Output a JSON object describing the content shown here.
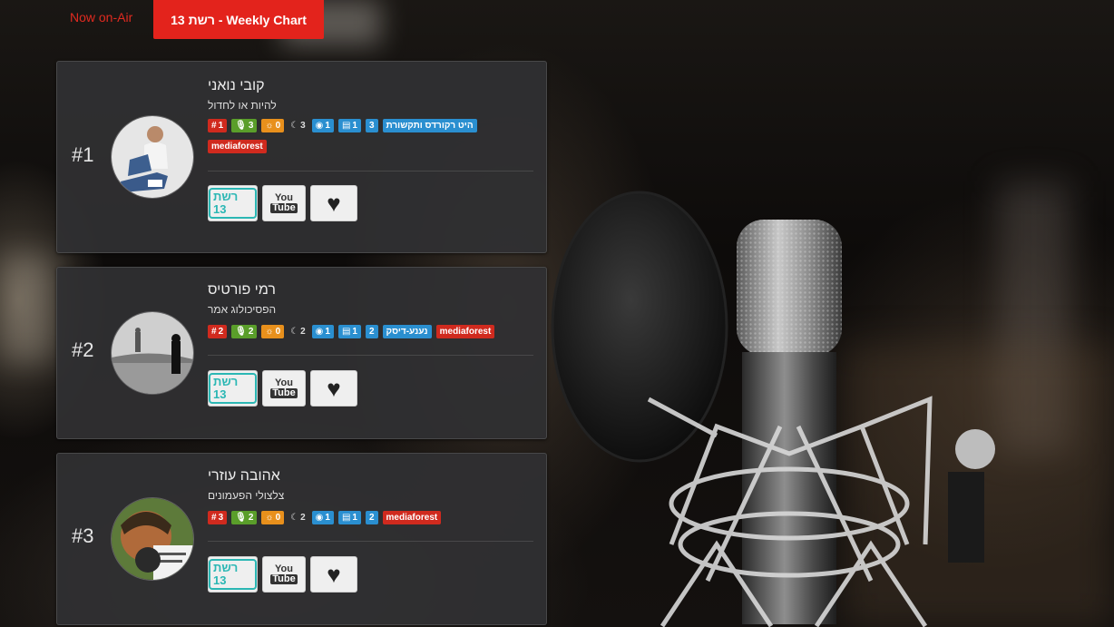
{
  "tabs": {
    "now_on_air": "Now on-Air",
    "weekly_chart": "רשת 13 - Weekly Chart"
  },
  "colors": {
    "accent_red": "#e3231c",
    "badge_red": "#d02a1e",
    "badge_green": "#5a9e2a",
    "badge_orange": "#e8901c",
    "badge_blue": "#2a8fd0",
    "reshet_teal": "#2bb7b4"
  },
  "buttons": {
    "reshet_label": "רשת 13",
    "youtube_top": "You",
    "youtube_bottom": "Tube",
    "heart_icon": "♥"
  },
  "entries": [
    {
      "rank": "#1",
      "artist": "קובי נואני",
      "song": "להיות או לחדול",
      "chart_position": "1",
      "mic_count": "3",
      "sun_count": "0",
      "moon_count": "3",
      "globe_count": "1",
      "news_count": "1",
      "label_count": "3",
      "label_name": "היט רקורדס ותקשורת",
      "source": "mediaforest"
    },
    {
      "rank": "#2",
      "artist": "רמי פורטיס",
      "song": "הפסיכולוג אמר",
      "chart_position": "2",
      "mic_count": "2",
      "sun_count": "0",
      "moon_count": "2",
      "globe_count": "1",
      "news_count": "1",
      "label_count": "2",
      "label_name": "נענע-דיסק",
      "source": "mediaforest"
    },
    {
      "rank": "#3",
      "artist": "אהובה עוזרי",
      "song": "צלצולי הפעמונים",
      "chart_position": "3",
      "mic_count": "2",
      "sun_count": "0",
      "moon_count": "2",
      "globe_count": "1",
      "news_count": "1",
      "label_count": "2",
      "source": "mediaforest"
    }
  ]
}
